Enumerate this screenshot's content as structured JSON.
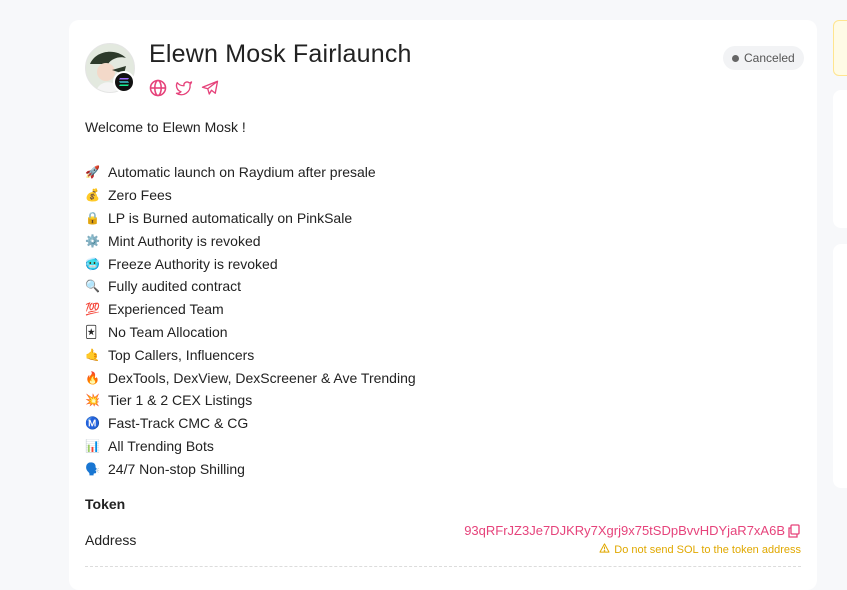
{
  "project": {
    "title": "Elewn Mosk Fairlaunch",
    "status": "Canceled",
    "links": [
      "globe-icon",
      "twitter-icon",
      "telegram-icon"
    ],
    "chain_icon": "solana-icon"
  },
  "description": {
    "welcome": "Welcome to Elewn Mosk !",
    "items": [
      {
        "emoji": "🚀",
        "text": "Automatic launch on Raydium after presale"
      },
      {
        "emoji": "💰",
        "text": "Zero Fees"
      },
      {
        "emoji": "🔒",
        "text": "LP is Burned automatically on PinkSale"
      },
      {
        "emoji": "⚙️",
        "text": "Mint Authority is revoked"
      },
      {
        "emoji": "🥶",
        "text": "Freeze Authority is revoked"
      },
      {
        "emoji": "🔍",
        "text": "Fully audited contract"
      },
      {
        "emoji": "💯",
        "text": "Experienced Team"
      },
      {
        "emoji": "🃏",
        "text": "No Team Allocation"
      },
      {
        "emoji": "🤙",
        "text": "Top Callers, Influencers"
      },
      {
        "emoji": "🔥",
        "text": "DexTools, DexView, DexScreener & Ave Trending"
      },
      {
        "emoji": "💥",
        "text": "Tier 1 & 2 CEX Listings"
      },
      {
        "emoji": "Ⓜ️",
        "text": "Fast-Track CMC & CG"
      },
      {
        "emoji": "📊",
        "text": "All Trending Bots"
      },
      {
        "emoji": "🗣️",
        "text": "24/7 Non-stop Shilling"
      }
    ]
  },
  "token": {
    "section_title": "Token",
    "address_label": "Address",
    "address": "93qRFrJZ3Je7DJKRy7Xgrj9x75tSDpBvvHDYjaR7xA6B",
    "warning": "Do not send SOL to the token address"
  },
  "colors": {
    "accent": "#e6437b",
    "warning": "#e0a800",
    "status_bg": "#f2f3f5"
  }
}
